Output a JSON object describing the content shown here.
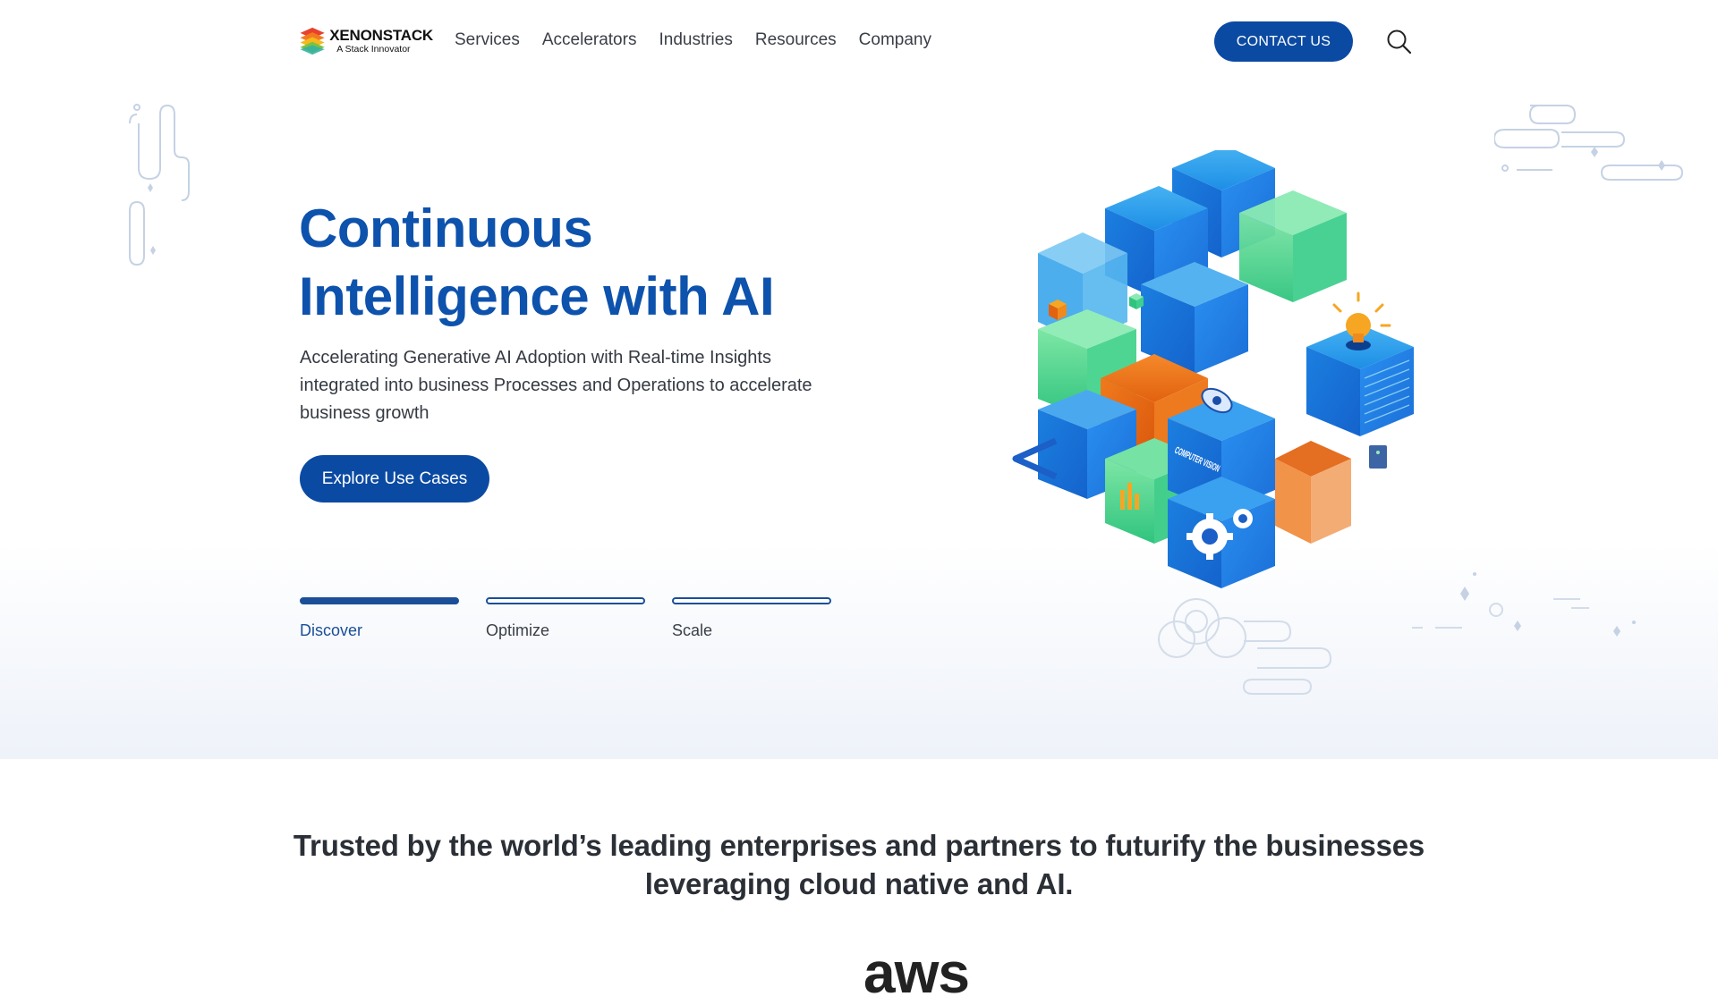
{
  "brand": {
    "name": "XENONSTACK",
    "tagline": "A Stack Innovator"
  },
  "nav": {
    "items": [
      {
        "label": "Services"
      },
      {
        "label": "Accelerators"
      },
      {
        "label": "Industries"
      },
      {
        "label": "Resources"
      },
      {
        "label": "Company"
      }
    ],
    "contact_label": "CONTACT US",
    "search_icon": "search-icon"
  },
  "hero": {
    "title_line1": "Continuous",
    "title_line2": "Intelligence with AI",
    "subtitle": "Accelerating Generative AI Adoption with Real-time Insights integrated into business Processes and Operations to accelerate business growth",
    "cta_label": "Explore Use Cases",
    "steps": [
      {
        "label": "Discover",
        "active": true
      },
      {
        "label": "Optimize",
        "active": false
      },
      {
        "label": "Scale",
        "active": false
      }
    ],
    "illustration_label": "COMPUTER VISION"
  },
  "trusted": {
    "line1": "Trusted by the world’s leading enterprises and partners to futurify the businesses",
    "line2": "leveraging cloud native and AI."
  },
  "partner_logo": "aws",
  "colors": {
    "primary": "#0b4aa2",
    "title": "#0d52ac",
    "orange": "#e25b12",
    "green": "#3fcf8e",
    "blue": "#1f7ae0"
  }
}
